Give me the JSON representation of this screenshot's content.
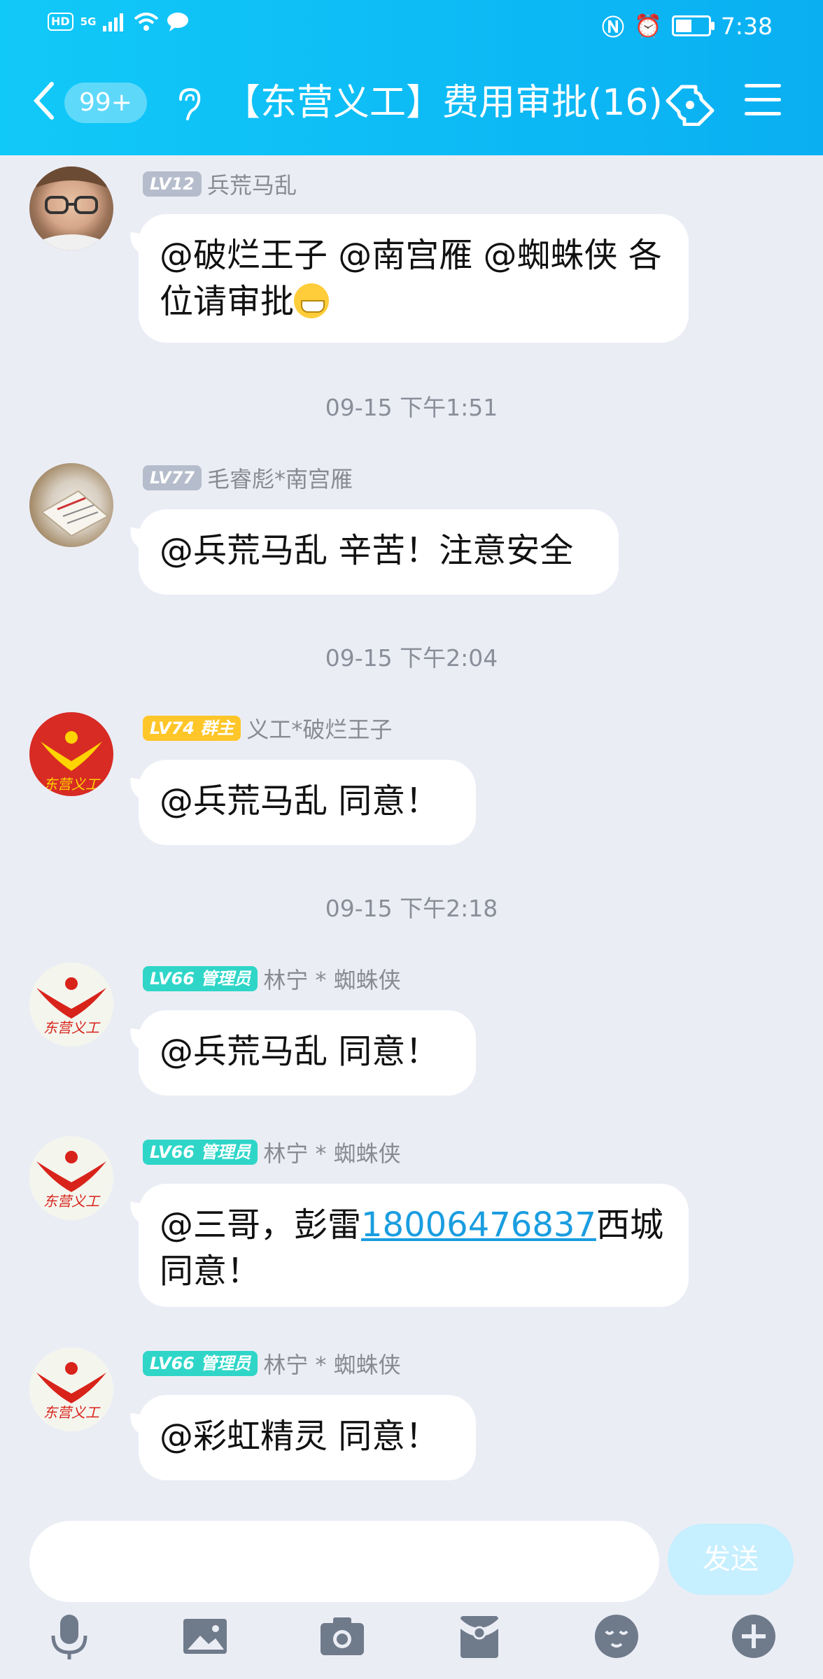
{
  "status_bar": {
    "hd": "HD",
    "network": "5G",
    "time": "7:38"
  },
  "header": {
    "unread_badge": "99+",
    "title": "【东营义工】费用审批(16)"
  },
  "messages": [
    {
      "level": "LV12",
      "name": "兵荒马乱",
      "text": "@破烂王子 @南宫雁 @蜘蛛侠 各位请审批"
    },
    {
      "timestamp": "09-15 下午1:51",
      "level": "LV77",
      "name": "毛睿彪*南宫雁",
      "text": "@兵荒马乱 辛苦！注意安全"
    },
    {
      "timestamp": "09-15 下午2:04",
      "level": "LV74",
      "role": "群主",
      "name": "义工*破烂王子",
      "text": "@兵荒马乱 同意！"
    },
    {
      "timestamp": "09-15 下午2:18",
      "level": "LV66",
      "role": "管理员",
      "name": "林宁 * 蜘蛛侠",
      "text": "@兵荒马乱 同意！"
    },
    {
      "level": "LV66",
      "role": "管理员",
      "name": "林宁 * 蜘蛛侠",
      "text_before": "@三哥，彭雷",
      "phone": "18006476837",
      "text_after": "西城 同意！"
    },
    {
      "level": "LV66",
      "role": "管理员",
      "name": "林宁 * 蜘蛛侠",
      "text": "@彩虹精灵 同意！"
    }
  ],
  "input": {
    "send_label": "发送"
  },
  "icons": [
    "mic-icon",
    "image-icon",
    "camera-icon",
    "red-packet-icon",
    "emoji-icon",
    "plus-icon"
  ]
}
